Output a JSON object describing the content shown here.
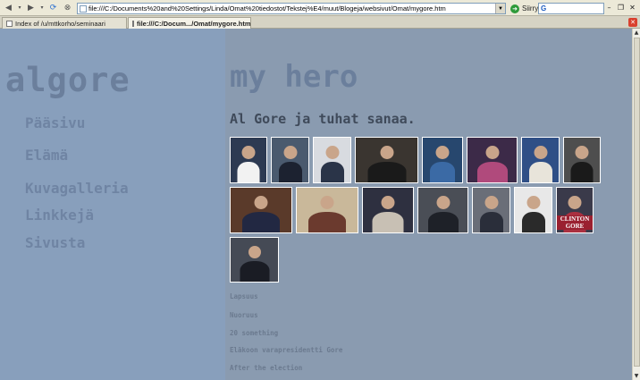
{
  "browser": {
    "address": "file:///C:/Documents%20and%20Settings/Linda/Omat%20tiedostot/Tekstej%E4/muut/Blogeja/websivut/Omat/mygore.htm",
    "go_label": "Siirry",
    "search_letter": "G",
    "tabs": [
      {
        "label": "Index of /u/mttkorho/seminaari",
        "active": false
      },
      {
        "label": "file:///C:/Docum.../Omat/mygore.htm",
        "active": true
      }
    ]
  },
  "site": {
    "title": "algore",
    "nav": [
      "Pääsivu",
      "Elämä",
      "Kuvagalleria",
      "Linkkejä",
      "Sivusta"
    ]
  },
  "main": {
    "title": "my hero",
    "subtitle": "Al Gore ja tuhat sanaa.",
    "links": [
      "Lapsuus",
      "Nuoruus",
      "20 something",
      "Eläkoon varapresidentti Gore",
      "After the election"
    ]
  },
  "gallery": [
    {
      "name": "gallery-photo-1",
      "bg": "#2d3a52",
      "fig": "#f2f2f2"
    },
    {
      "name": "gallery-photo-2",
      "bg": "#4a5a6e",
      "fig": "#1c2230"
    },
    {
      "name": "gallery-photo-3",
      "bg": "#d8dbe0",
      "fig": "#2a3448"
    },
    {
      "name": "gallery-photo-4",
      "bg": "#3a3530",
      "fig": "#1a1a1a"
    },
    {
      "name": "gallery-photo-5",
      "bg": "#27476e",
      "fig": "#3b6aa5"
    },
    {
      "name": "gallery-photo-6",
      "bg": "#3c2a48",
      "fig": "#b04a7c"
    },
    {
      "name": "gallery-photo-7",
      "bg": "#2f4f86",
      "fig": "#e8e4da"
    },
    {
      "name": "gallery-photo-8",
      "bg": "#4e4e4e",
      "fig": "#1a1a1a"
    },
    {
      "name": "gallery-photo-9",
      "bg": "#5a3a2a",
      "fig": "#222842"
    },
    {
      "name": "gallery-photo-10",
      "bg": "#c9b89a",
      "fig": "#6b3a2e"
    },
    {
      "name": "gallery-photo-11",
      "bg": "#2e3040",
      "fig": "#c8c0b4"
    },
    {
      "name": "gallery-photo-12",
      "bg": "#4a4e56",
      "fig": "#1e2128"
    },
    {
      "name": "gallery-photo-13",
      "bg": "#6a6e78",
      "fig": "#2a2e3a"
    },
    {
      "name": "gallery-photo-14",
      "bg": "#e8e8e8",
      "fig": "#2a2a2a"
    },
    {
      "name": "gallery-photo-15",
      "bg": "#3a3a4a",
      "fig": "#aa3040"
    },
    {
      "name": "gallery-photo-16",
      "bg": "#454a55",
      "fig": "#1a1c24"
    }
  ],
  "gallery_text": {
    "photo_15_caption": "CLINTON GORE"
  }
}
